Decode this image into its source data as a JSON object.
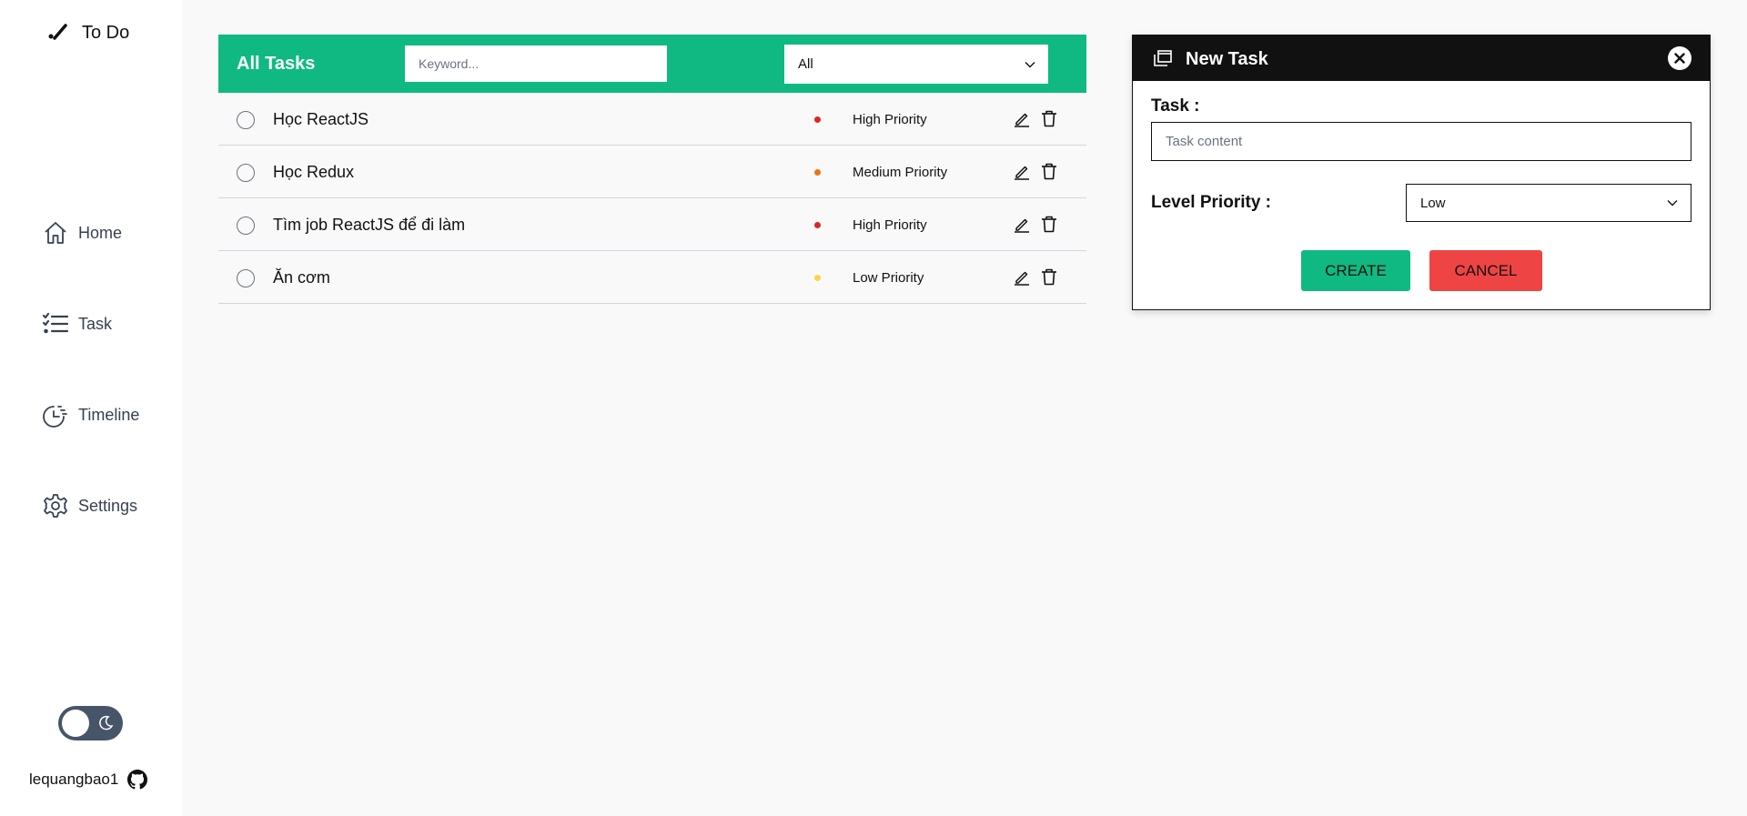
{
  "app": {
    "title": "To Do"
  },
  "sidebar": {
    "items": [
      {
        "label": "Home",
        "icon": "home-icon"
      },
      {
        "label": "Task",
        "icon": "task-list-icon"
      },
      {
        "label": "Timeline",
        "icon": "timeline-icon"
      },
      {
        "label": "Settings",
        "icon": "gear-icon"
      }
    ],
    "theme_toggle": {
      "state": "light",
      "icon": "moon-icon"
    },
    "user": {
      "name": "lequangbao1",
      "icon": "github-icon"
    }
  },
  "tasks_panel": {
    "title": "All Tasks",
    "search": {
      "placeholder": "Keyword...",
      "value": ""
    },
    "filter": {
      "selected": "All"
    },
    "tasks": [
      {
        "name": "Học ReactJS",
        "priority": "High Priority",
        "color": "#dc2626"
      },
      {
        "name": "Học Redux",
        "priority": "Medium Priority",
        "color": "#ea7317"
      },
      {
        "name": "Tìm job ReactJS để đi làm",
        "priority": "High Priority",
        "color": "#dc2626"
      },
      {
        "name": "Ăn cơm",
        "priority": "Low Priority",
        "color": "#fcd34d"
      }
    ]
  },
  "new_task_modal": {
    "title": "New Task",
    "task_label": "Task :",
    "task_placeholder": "Task content",
    "level_label": "Level Priority :",
    "level_selected": "Low",
    "create_label": "CREATE",
    "cancel_label": "CANCEL"
  },
  "colors": {
    "accent": "#10b981",
    "danger": "#ef4444",
    "modal_header": "#111111",
    "toggle": "#475569"
  }
}
